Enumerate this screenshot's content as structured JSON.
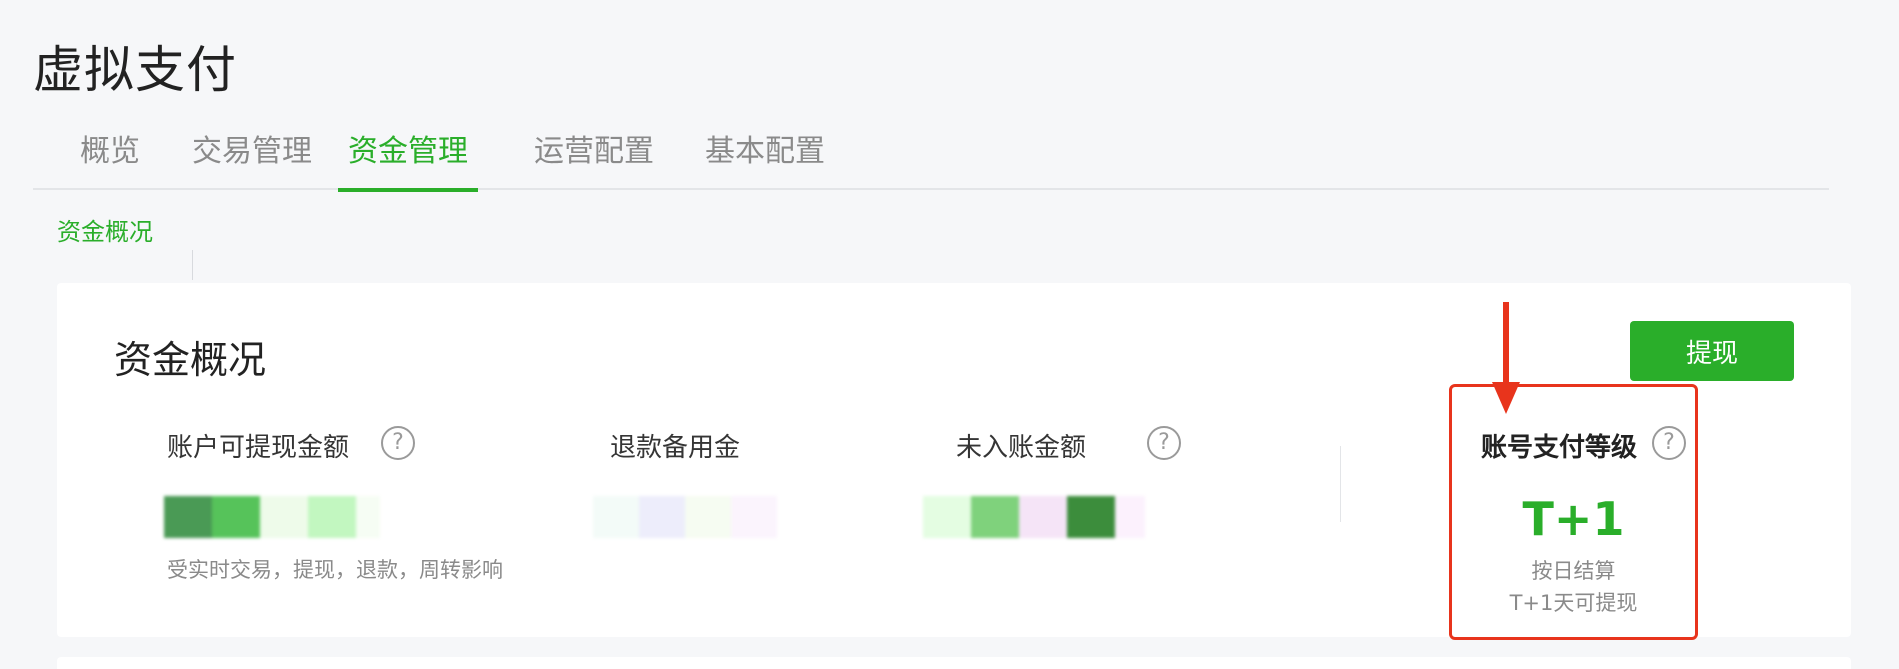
{
  "page": {
    "title": "虚拟支付"
  },
  "tabs": [
    {
      "label": "概览",
      "active": false
    },
    {
      "label": "交易管理",
      "active": false
    },
    {
      "label": "资金管理",
      "active": true
    },
    {
      "label": "运营配置",
      "active": false
    },
    {
      "label": "基本配置",
      "active": false
    }
  ],
  "subnav": {
    "label": "资金概况"
  },
  "card": {
    "title": "资金概况",
    "withdraw_label": "提现",
    "metrics": [
      {
        "label": "账户可提现金额",
        "note": "受实时交易，提现，退款，周转影响",
        "has_help": true
      },
      {
        "label": "退款备用金",
        "note": "",
        "has_help": false
      },
      {
        "label": "未入账金额",
        "note": "",
        "has_help": true
      }
    ],
    "pay_level": {
      "label": "账号支付等级",
      "value": "T+1",
      "desc_line1": "按日结算",
      "desc_line2": "T+1天可提现"
    },
    "help_glyph": "?"
  },
  "colors": {
    "accent": "#2aae2a",
    "highlight": "#e8341c",
    "background": "#f6f7f9"
  },
  "icons": [
    "question-mark-icon",
    "arrow-down-icon"
  ]
}
